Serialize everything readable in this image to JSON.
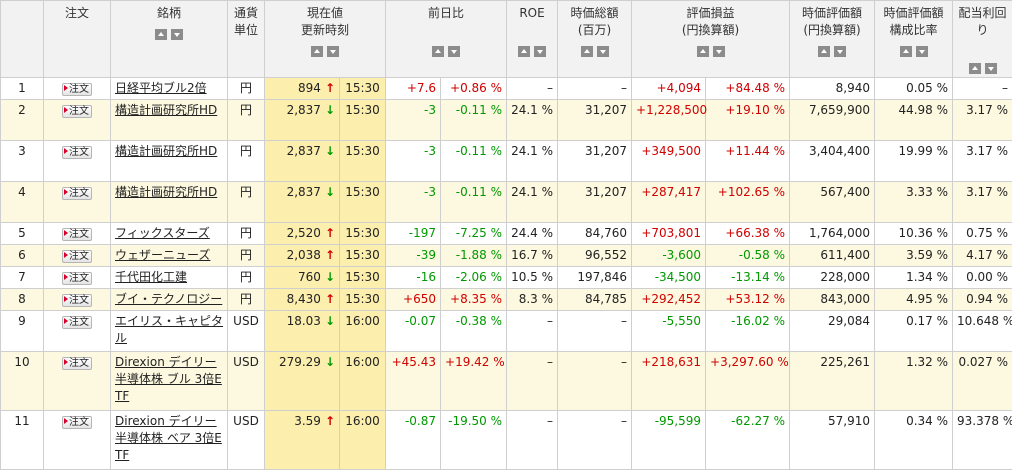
{
  "headers": {
    "no": "",
    "order": "注文",
    "name": "銘柄",
    "currency_l1": "通貨",
    "currency_l2": "単位",
    "price_l1": "現在値",
    "price_l2": "更新時刻",
    "change": "前日比",
    "roe": "ROE",
    "cap_l1": "時価総額",
    "cap_l2": "(百万)",
    "pl_l1": "評価損益",
    "pl_l2": "(円換算額)",
    "val_l1": "時価評価額",
    "val_l2": "(円換算額)",
    "ratio_l1": "時価評価額",
    "ratio_l2": "構成比率",
    "div": "配当利回り"
  },
  "order_button_label": "注文",
  "rows": [
    {
      "no": "1",
      "name": "日経平均ブル2倍",
      "cur": "円",
      "price": "894",
      "dir": "up",
      "time": "15:30",
      "chg": "+7.6",
      "chg_pct": "+0.86 %",
      "roe": "–",
      "cap": "–",
      "pl": "+4,094",
      "pl_pct": "+84.48 %",
      "val": "8,940",
      "ratio": "0.05 %",
      "div": "–"
    },
    {
      "no": "2",
      "name": "構造計画研究所HD",
      "cur": "円",
      "price": "2,837",
      "dir": "down",
      "time": "15:30",
      "chg": "-3",
      "chg_pct": "-0.11 %",
      "roe": "24.1 %",
      "cap": "31,207",
      "pl": "+1,228,500",
      "pl_pct": "+19.10 %",
      "val": "7,659,900",
      "ratio": "44.98 %",
      "div": "3.17 %"
    },
    {
      "no": "3",
      "name": "構造計画研究所HD",
      "cur": "円",
      "price": "2,837",
      "dir": "down",
      "time": "15:30",
      "chg": "-3",
      "chg_pct": "-0.11 %",
      "roe": "24.1 %",
      "cap": "31,207",
      "pl": "+349,500",
      "pl_pct": "+11.44 %",
      "val": "3,404,400",
      "ratio": "19.99 %",
      "div": "3.17 %"
    },
    {
      "no": "4",
      "name": "構造計画研究所HD",
      "cur": "円",
      "price": "2,837",
      "dir": "down",
      "time": "15:30",
      "chg": "-3",
      "chg_pct": "-0.11 %",
      "roe": "24.1 %",
      "cap": "31,207",
      "pl": "+287,417",
      "pl_pct": "+102.65 %",
      "val": "567,400",
      "ratio": "3.33 %",
      "div": "3.17 %"
    },
    {
      "no": "5",
      "name": "フィックスターズ",
      "cur": "円",
      "price": "2,520",
      "dir": "up",
      "time": "15:30",
      "chg": "-197",
      "chg_pct": "-7.25 %",
      "roe": "24.4 %",
      "cap": "84,760",
      "pl": "+703,801",
      "pl_pct": "+66.38 %",
      "val": "1,764,000",
      "ratio": "10.36 %",
      "div": "0.75 %"
    },
    {
      "no": "6",
      "name": "ウェザーニューズ",
      "cur": "円",
      "price": "2,038",
      "dir": "up",
      "time": "15:30",
      "chg": "-39",
      "chg_pct": "-1.88 %",
      "roe": "16.7 %",
      "cap": "96,552",
      "pl": "-3,600",
      "pl_pct": "-0.58 %",
      "val": "611,400",
      "ratio": "3.59 %",
      "div": "4.17 %"
    },
    {
      "no": "7",
      "name": "千代田化工建",
      "cur": "円",
      "price": "760",
      "dir": "down",
      "time": "15:30",
      "chg": "-16",
      "chg_pct": "-2.06 %",
      "roe": "10.5 %",
      "cap": "197,846",
      "pl": "-34,500",
      "pl_pct": "-13.14 %",
      "val": "228,000",
      "ratio": "1.34 %",
      "div": "0.00 %"
    },
    {
      "no": "8",
      "name": "ブイ・テクノロジー",
      "cur": "円",
      "price": "8,430",
      "dir": "up",
      "time": "15:30",
      "chg": "+650",
      "chg_pct": "+8.35 %",
      "roe": "8.3 %",
      "cap": "84,785",
      "pl": "+292,452",
      "pl_pct": "+53.12 %",
      "val": "843,000",
      "ratio": "4.95 %",
      "div": "0.94 %"
    },
    {
      "no": "9",
      "name": "エイリス・キャピタル",
      "cur": "USD",
      "price": "18.03",
      "dir": "down",
      "time": "16:00",
      "chg": "-0.07",
      "chg_pct": "-0.38 %",
      "roe": "–",
      "cap": "–",
      "pl": "-5,550",
      "pl_pct": "-16.02 %",
      "val": "29,084",
      "ratio": "0.17 %",
      "div": "10.648 %"
    },
    {
      "no": "10",
      "name": "Direxion デイリー半導体株 ブル 3倍ETF",
      "cur": "USD",
      "price": "279.29",
      "dir": "down",
      "time": "16:00",
      "chg": "+45.43",
      "chg_pct": "+19.42 %",
      "roe": "–",
      "cap": "–",
      "pl": "+218,631",
      "pl_pct": "+3,297.60 %",
      "val": "225,261",
      "ratio": "1.32 %",
      "div": "0.027 %"
    },
    {
      "no": "11",
      "name": "Direxion デイリー半導体株 ベア 3倍ETF",
      "cur": "USD",
      "price": "3.59",
      "dir": "up",
      "time": "16:00",
      "chg": "-0.87",
      "chg_pct": "-19.50 %",
      "roe": "–",
      "cap": "–",
      "pl": "-95,599",
      "pl_pct": "-62.27 %",
      "val": "57,910",
      "ratio": "0.34 %",
      "div": "93.378 %"
    }
  ],
  "colors": {
    "positive": "#d00000",
    "negative": "#009900",
    "price_highlight": "#fcefae",
    "alt_row": "#fdf9e0",
    "header_bg": "#f2f2f2"
  },
  "icons": {
    "sort_asc": "triangle-up-icon",
    "sort_desc": "triangle-down-icon",
    "order": "play-triangle-icon",
    "trend_up": "arrow-up-icon",
    "trend_down": "arrow-down-icon"
  }
}
